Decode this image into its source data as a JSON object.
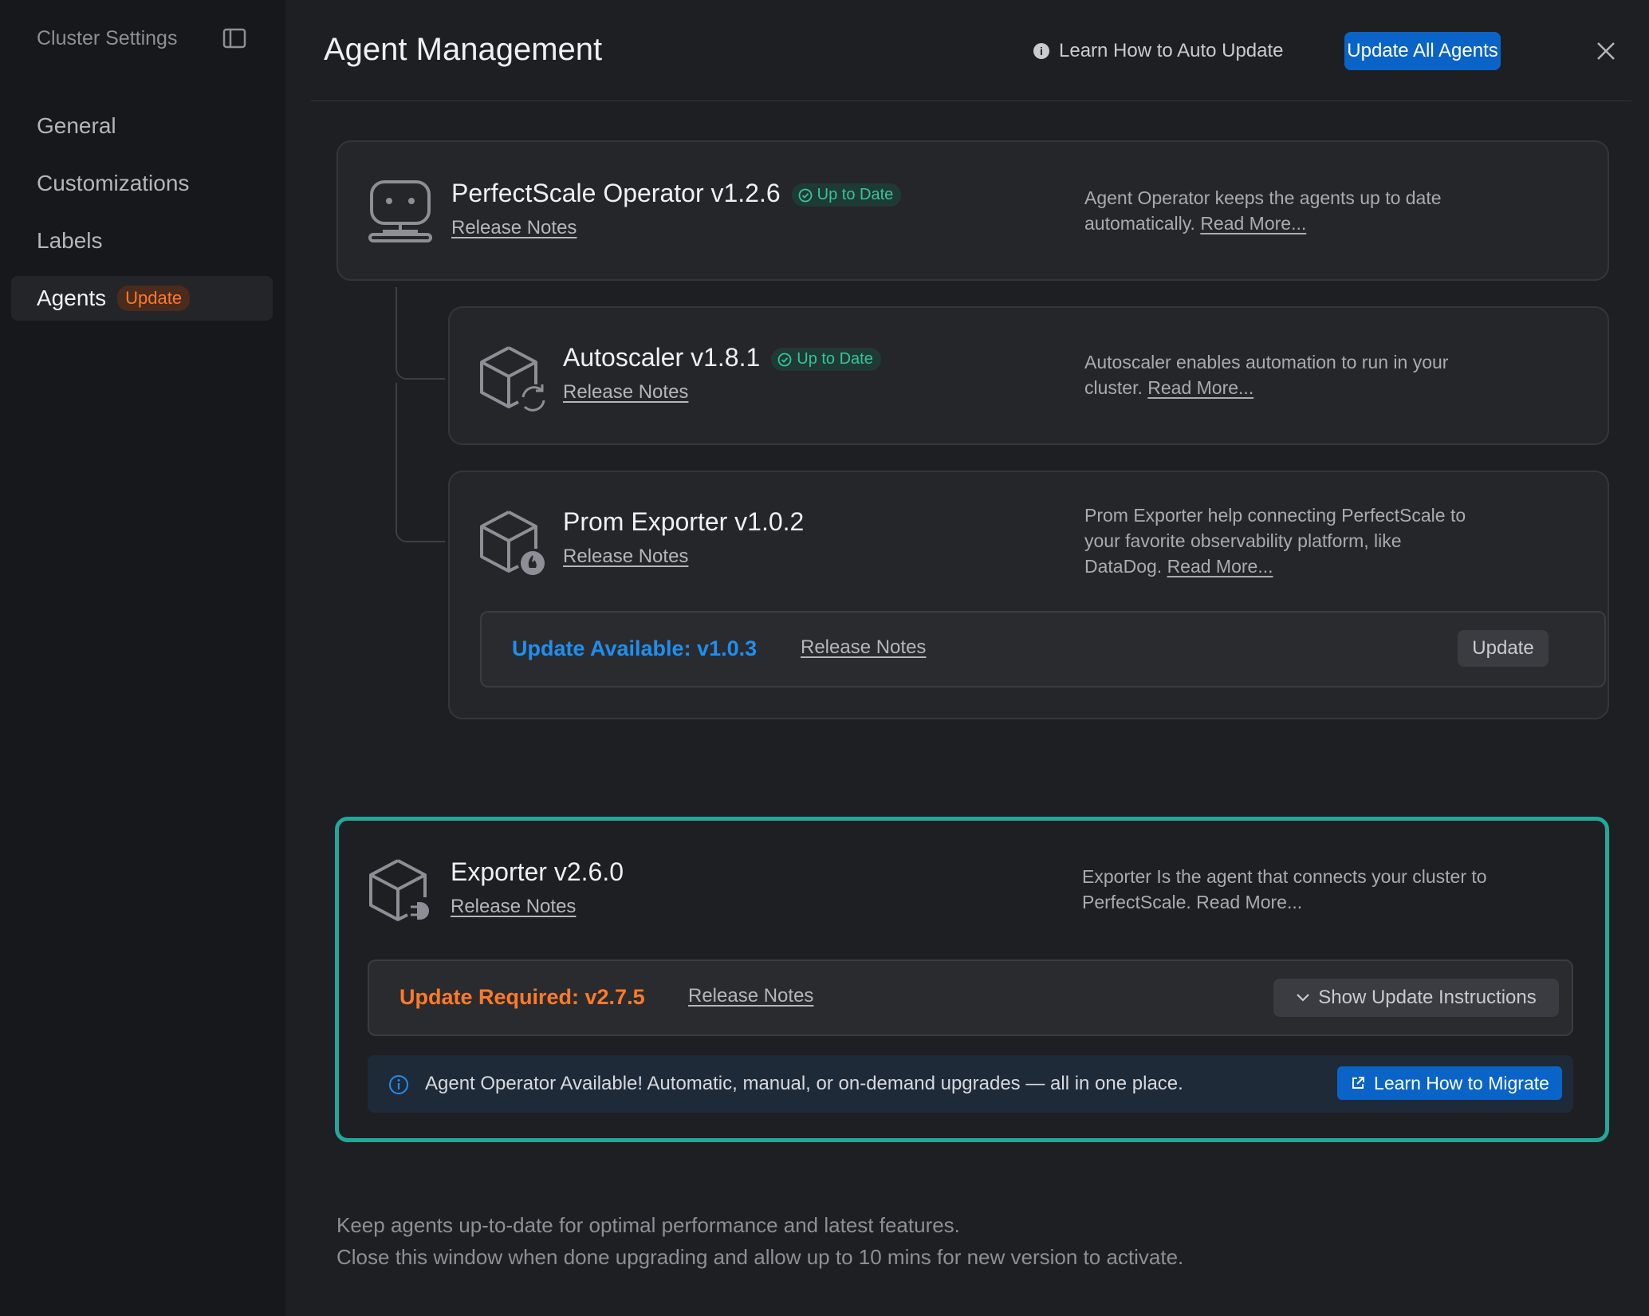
{
  "sidebar": {
    "title": "Cluster Settings",
    "items": [
      {
        "label": "General"
      },
      {
        "label": "Customizations"
      },
      {
        "label": "Labels"
      },
      {
        "label": "Agents",
        "badge": "Update"
      }
    ]
  },
  "header": {
    "title": "Agent Management",
    "auto_update_link": "Learn How to Auto Update",
    "update_all_label": "Update All Agents"
  },
  "agents": {
    "operator": {
      "name": "PerfectScale Operator v1.2.6",
      "status": "Up to Date",
      "release_notes": "Release Notes",
      "desc": "Agent Operator keeps the agents up to date automatically.",
      "read_more": "Read More..."
    },
    "autoscaler": {
      "name": "Autoscaler v1.8.1",
      "status": "Up to Date",
      "release_notes": "Release Notes",
      "desc": "Autoscaler enables automation to run in your cluster.",
      "read_more": "Read More..."
    },
    "prom": {
      "name": "Prom Exporter v1.0.2",
      "release_notes": "Release Notes",
      "desc": "Prom Exporter help connecting PerfectScale to your favorite observability platform, like DataDog.",
      "read_more": "Read More...",
      "update_text": "Update Available: v1.0.3",
      "update_release_notes": "Release Notes",
      "update_button": "Update"
    },
    "exporter": {
      "name": "Exporter v2.6.0",
      "release_notes": "Release Notes",
      "desc": "Exporter Is the agent that connects your cluster to PerfectScale. Read More...",
      "update_text": "Update Required: v2.7.5",
      "update_release_notes": "Release Notes",
      "instructions_button": "Show Update Instructions",
      "banner_text": "Agent Operator Available! Automatic, manual, or on-demand upgrades — all in one place.",
      "migrate_button": "Learn How to Migrate"
    }
  },
  "footer": {
    "line1": "Keep agents up-to-date for optimal performance and latest features.",
    "line2": "Close this window when done upgrading and allow up to 10 mins for new version to activate."
  },
  "colors": {
    "accent_blue": "#0a64c8",
    "status_green": "#38c39c",
    "update_orange": "#ff7a2a",
    "highlight_teal": "#22a89a"
  }
}
